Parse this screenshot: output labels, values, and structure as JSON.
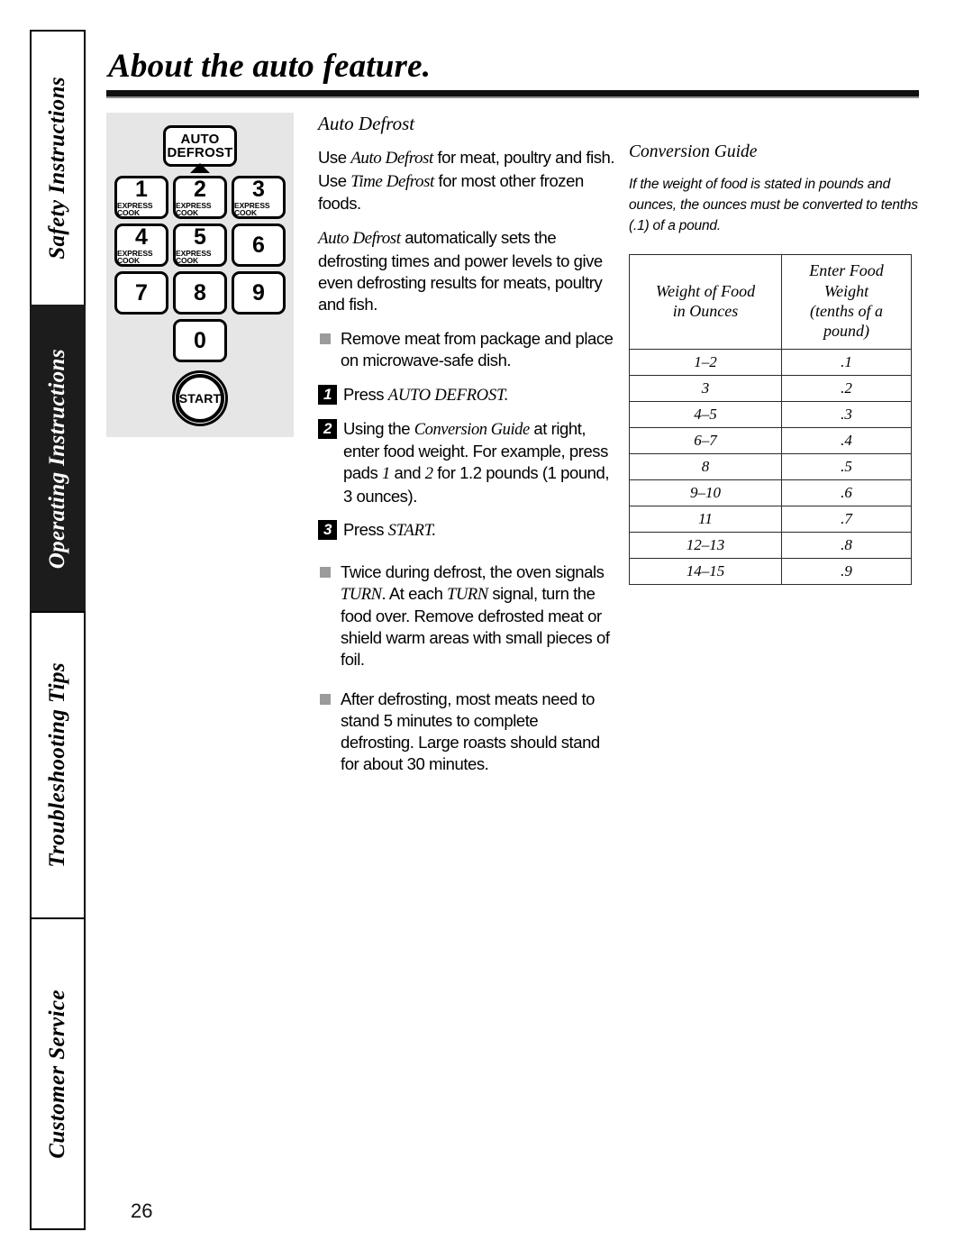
{
  "page": {
    "title": "About the auto feature.",
    "number": "26"
  },
  "sidebar": {
    "tabs": [
      {
        "label": "Safety Instructions",
        "active": false
      },
      {
        "label": "Operating Instructions",
        "active": true
      },
      {
        "label": "Troubleshooting Tips",
        "active": false
      },
      {
        "label": "Customer Service",
        "active": false
      }
    ]
  },
  "keypad": {
    "defrost": {
      "line1": "AUTO",
      "line2": "DEFROST"
    },
    "express_label": "EXPRESS COOK",
    "keys": [
      {
        "num": "1",
        "sub": "EXPRESS COOK"
      },
      {
        "num": "2",
        "sub": "EXPRESS COOK"
      },
      {
        "num": "3",
        "sub": "EXPRESS COOK"
      },
      {
        "num": "4",
        "sub": "EXPRESS COOK"
      },
      {
        "num": "5",
        "sub": "EXPRESS COOK"
      },
      {
        "num": "6",
        "sub": ""
      },
      {
        "num": "7",
        "sub": ""
      },
      {
        "num": "8",
        "sub": ""
      },
      {
        "num": "9",
        "sub": ""
      }
    ],
    "key_zero": {
      "num": "0",
      "sub": ""
    },
    "start": "START"
  },
  "main": {
    "heading": "Auto Defrost",
    "para1_a": "Use ",
    "para1_b": "Auto Defrost",
    "para1_c": " for meat, poultry and fish. Use ",
    "para1_d": "Time Defrost",
    "para1_e": " for most other frozen foods.",
    "para2_a": "Auto Defrost",
    "para2_b": " automatically sets the defrosting times and power levels to give even defrosting results for meats, poultry and fish.",
    "bullet1": "Remove meat from package and place on microwave-safe dish.",
    "step1_num": "1",
    "step1_a": "Press ",
    "step1_b": "AUTO DEFROST.",
    "step2_num": "2",
    "step2_a": "Using the ",
    "step2_b": "Conversion Guide",
    "step2_c": " at right, enter food weight. For example, press pads ",
    "step2_d": "1",
    "step2_e": " and ",
    "step2_f": "2",
    "step2_g": " for 1.2 pounds (1 pound, 3 ounces).",
    "step3_num": "3",
    "step3_a": "Press ",
    "step3_b": "START.",
    "bullet2_a": "Twice during defrost, the oven signals ",
    "bullet2_b": "TURN",
    "bullet2_c": ". At each ",
    "bullet2_d": "TURN",
    "bullet2_e": " signal, turn the food over. Remove defrosted meat or shield warm areas with small pieces of foil.",
    "bullet3": "After defrosting, most meats need to stand 5 minutes to complete defrosting. Large roasts should stand for about 30 minutes."
  },
  "conversion_guide": {
    "heading": "Conversion Guide",
    "note": "If the weight of food is stated in pounds and ounces, the ounces must be converted to tenths (.1) of a pound.",
    "columns": [
      {
        "line1": "Weight of Food",
        "line2": "in Ounces"
      },
      {
        "line1": "Enter Food Weight",
        "line2": "(tenths of a pound)"
      }
    ],
    "rows": [
      {
        "ounces": "1–2",
        "tenths": ".1"
      },
      {
        "ounces": "3",
        "tenths": ".2"
      },
      {
        "ounces": "4–5",
        "tenths": ".3"
      },
      {
        "ounces": "6–7",
        "tenths": ".4"
      },
      {
        "ounces": "8",
        "tenths": ".5"
      },
      {
        "ounces": "9–10",
        "tenths": ".6"
      },
      {
        "ounces": "11",
        "tenths": ".7"
      },
      {
        "ounces": "12–13",
        "tenths": ".8"
      },
      {
        "ounces": "14–15",
        "tenths": ".9"
      }
    ]
  },
  "colors": {
    "panel_gray": "#e6e6e6",
    "bullet_gray": "#9b9b9b",
    "ink": "#000000",
    "active_tab_bg": "#1c1c1c"
  }
}
